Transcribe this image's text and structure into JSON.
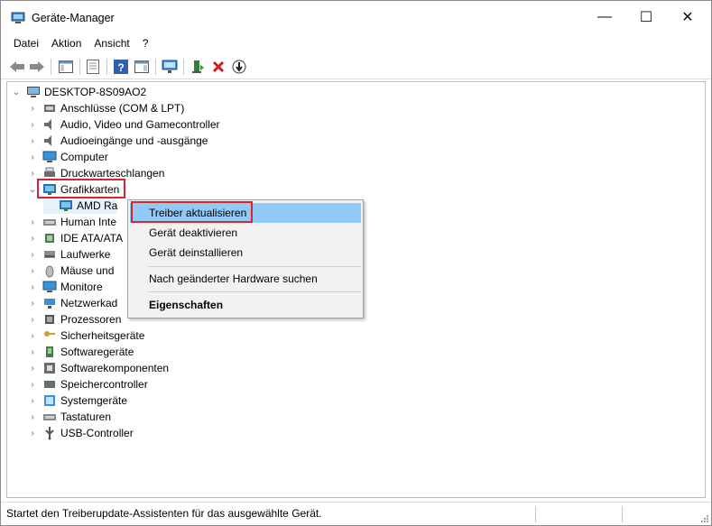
{
  "window": {
    "title": "Geräte-Manager",
    "controls": {
      "minimize": "—",
      "maximize": "☐",
      "close": "✕"
    }
  },
  "menubar": [
    {
      "label": "Datei"
    },
    {
      "label": "Aktion"
    },
    {
      "label": "Ansicht"
    },
    {
      "label": "?"
    }
  ],
  "toolbar": {
    "icons": [
      "back-icon",
      "forward-icon",
      "show-hide-console-tree-icon",
      "properties-icon",
      "help-icon",
      "action-pane-icon",
      "scan-hardware-icon",
      "update-driver-icon",
      "uninstall-device-icon",
      "disable-device-icon"
    ]
  },
  "tree": {
    "root": {
      "label": "DESKTOP-8S09AO2",
      "icon": "computer-icon",
      "expanded": true
    },
    "categories": [
      {
        "label": "Anschlüsse (COM & LPT)",
        "icon": "port-icon"
      },
      {
        "label": "Audio, Video und Gamecontroller",
        "icon": "speaker-icon"
      },
      {
        "label": "Audioeingänge und -ausgänge",
        "icon": "speaker-icon"
      },
      {
        "label": "Computer",
        "icon": "monitor-icon"
      },
      {
        "label": "Druckwarteschlangen",
        "icon": "printer-icon"
      },
      {
        "label": "Grafikkarten",
        "icon": "display-adapter-icon",
        "expanded": true
      },
      {
        "label": "AMD Ra",
        "icon": "display-adapter-icon",
        "child": true
      },
      {
        "label": "Human Inte",
        "icon": "keyboard-icon"
      },
      {
        "label": "IDE ATA/ATA",
        "icon": "chip-icon"
      },
      {
        "label": "Laufwerke",
        "icon": "disk-icon"
      },
      {
        "label": "Mäuse und",
        "icon": "mouse-icon"
      },
      {
        "label": "Monitore",
        "icon": "monitor-icon"
      },
      {
        "label": "Netzwerkad",
        "icon": "network-icon"
      },
      {
        "label": "Prozessoren",
        "icon": "processor-icon"
      },
      {
        "label": "Sicherheitsgeräte",
        "icon": "key-icon"
      },
      {
        "label": "Softwaregeräte",
        "icon": "device-icon"
      },
      {
        "label": "Softwarekomponenten",
        "icon": "component-icon"
      },
      {
        "label": "Speichercontroller",
        "icon": "storage-icon"
      },
      {
        "label": "Systemgeräte",
        "icon": "system-icon"
      },
      {
        "label": "Tastaturen",
        "icon": "keyboard-icon"
      },
      {
        "label": "USB-Controller",
        "icon": "usb-icon"
      }
    ]
  },
  "context_menu": {
    "items": [
      {
        "label": "Treiber aktualisieren",
        "active": true
      },
      {
        "label": "Gerät deaktivieren"
      },
      {
        "label": "Gerät deinstallieren"
      },
      {
        "label": "Nach geänderter Hardware suchen"
      },
      {
        "label": "Eigenschaften",
        "bold": true
      }
    ]
  },
  "statusbar": {
    "text": "Startet den Treiberupdate-Assistenten für das ausgewählte Gerät."
  },
  "colors": {
    "highlight_border": "#d9262d",
    "menu_active": "#91c9f7"
  }
}
